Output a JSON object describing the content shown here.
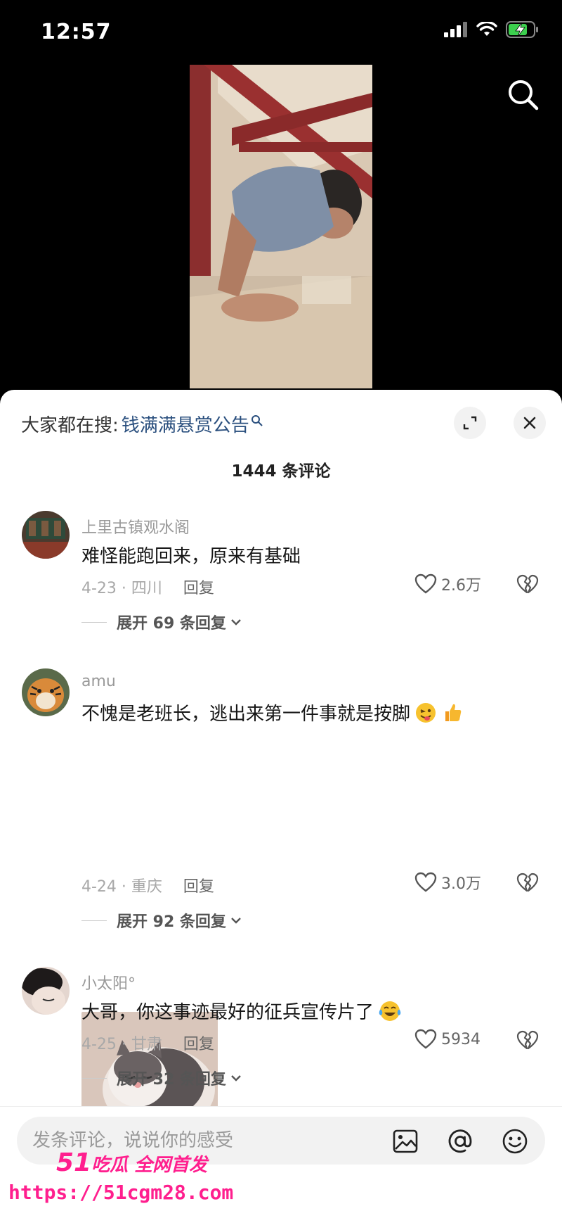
{
  "status_bar": {
    "time": "12:57"
  },
  "sheet": {
    "trending_prefix": "大家都在搜:",
    "trending_query": "钱满满悬赏公告",
    "comment_count": "1444 条评论"
  },
  "comments": [
    {
      "user": "上里古镇观水阁",
      "text": "难怪能跑回来，原来有基础",
      "date_location": "4-23 · 四川",
      "reply_label": "回复",
      "likes": "2.6万",
      "expand_label": "展开 69 条回复"
    },
    {
      "user": "amu",
      "text": "不愧是老班长，逃出来第一件事就是按脚",
      "emojis": [
        "wink-tongue-emoji",
        "thumbs-up-emoji"
      ],
      "date_location": "4-24 · 重庆",
      "reply_label": "回复",
      "likes": "3.0万",
      "expand_label": "展开 92 条回复"
    },
    {
      "user": "小太阳°",
      "text": "大哥，你这事迹最好的征兵宣传片了",
      "emojis": [
        "crying-laughing-emoji"
      ],
      "date_location": "4-25 · 甘肃",
      "reply_label": "回复",
      "likes": "5934",
      "expand_label": "展开 32 条回复"
    }
  ],
  "input_bar": {
    "placeholder": "发条评论，说说你的感受"
  },
  "watermark": {
    "brand_number": "51",
    "brand_text": "吃瓜 全网首发",
    "url": "https://51cgm28.com"
  },
  "colors": {
    "accent_link": "#2a4f7e",
    "watermark": "#ff1f8e",
    "sheet_bg": "#ffffff"
  },
  "icons": [
    "search-icon",
    "expand-icon",
    "close-icon",
    "heart-icon",
    "broken-heart-icon",
    "chevron-down-icon",
    "image-icon",
    "at-icon",
    "smile-icon"
  ]
}
